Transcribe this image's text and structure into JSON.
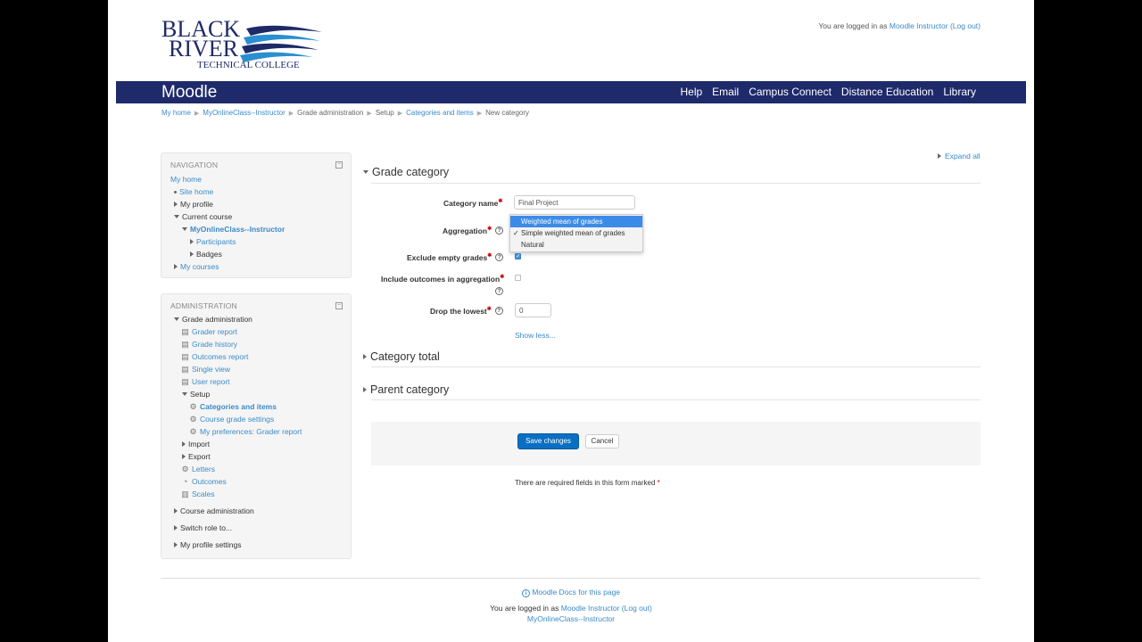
{
  "header": {
    "logo_line1": "BLACK",
    "logo_line2": "RIVER",
    "logo_line3": "TECHNICAL COLLEGE",
    "login_prefix": "You are logged in as",
    "login_user": "Moodle Instructor",
    "logout": "(Log out)"
  },
  "navbar": {
    "brand": "Moodle",
    "links": [
      "Help",
      "Email",
      "Campus Connect",
      "Distance Education",
      "Library"
    ]
  },
  "breadcrumb": [
    "My home",
    "MyOnlineClass--Instructor",
    "Grade administration",
    "Setup",
    "Categories and items",
    "New category"
  ],
  "navigation": {
    "title": "NAVIGATION",
    "my_home": "My home",
    "site_home": "Site home",
    "my_profile": "My profile",
    "current_course": "Current course",
    "course_name": "MyOnlineClass--Instructor",
    "participants": "Participants",
    "badges": "Badges",
    "my_courses": "My courses"
  },
  "administration": {
    "title": "ADMINISTRATION",
    "grade_admin": "Grade administration",
    "grader_report": "Grader report",
    "grade_history": "Grade history",
    "outcomes_report": "Outcomes report",
    "single_view": "Single view",
    "user_report": "User report",
    "setup": "Setup",
    "categories_items": "Categories and items",
    "course_grade_settings": "Course grade settings",
    "my_preferences": "My preferences: Grader report",
    "import": "Import",
    "export": "Export",
    "letters": "Letters",
    "outcomes": "Outcomes",
    "scales": "Scales",
    "course_admin": "Course administration",
    "switch_role": "Switch role to...",
    "my_profile_settings": "My profile settings"
  },
  "form": {
    "expand_all": "Expand all",
    "section_grade_category": "Grade category",
    "category_name_label": "Category name",
    "category_name_value": "Final Project",
    "aggregation_label": "Aggregation",
    "aggregation_options": [
      "Weighted mean of grades",
      "Simple weighted mean of grades",
      "Natural"
    ],
    "aggregation_checked": "✓",
    "exclude_empty_label": "Exclude empty grades",
    "include_outcomes_label": "Include outcomes in aggregation",
    "drop_lowest_label": "Drop the lowest",
    "drop_lowest_value": "0",
    "show_less": "Show less...",
    "section_category_total": "Category total",
    "section_parent_category": "Parent category",
    "save_button": "Save changes",
    "cancel_button": "Cancel",
    "required_note": "There are required fields in this form marked",
    "required_mark": "*"
  },
  "footer": {
    "docs_link": "Moodle Docs for this page",
    "login_prefix": "You are logged in as",
    "login_user": "Moodle Instructor",
    "logout": "(Log out)",
    "course": "MyOnlineClass--Instructor"
  },
  "colors": {
    "navbar": "#1f2a6b",
    "link": "#3a8bc9",
    "primary_button": "#0a6fc2",
    "selection": "#3d8be8"
  }
}
